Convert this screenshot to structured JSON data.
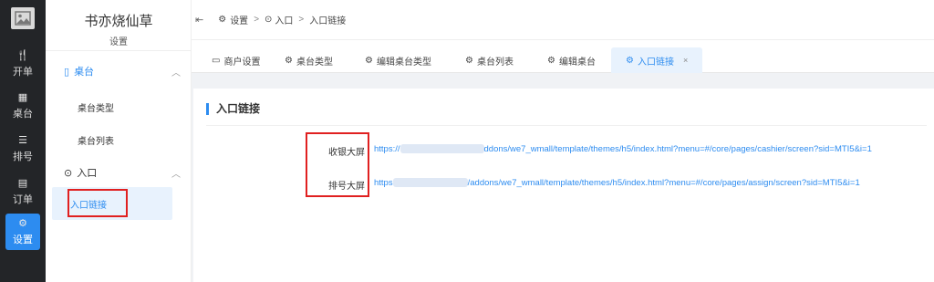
{
  "rail": {
    "items": [
      {
        "icon": "🍴",
        "label": "开单"
      },
      {
        "icon": "▦",
        "label": "桌台"
      },
      {
        "icon": "☰",
        "label": "排号"
      },
      {
        "icon": "▤",
        "label": "订单"
      },
      {
        "icon": "⚙",
        "label": "设置"
      }
    ]
  },
  "sidebar": {
    "brand": "书亦烧仙草",
    "subtitle": "设置",
    "groups": [
      {
        "label": "桌台",
        "icon": "▯",
        "items": [
          "桌台类型",
          "桌台列表"
        ]
      },
      {
        "label": "入口",
        "icon": "⊙",
        "items": [
          "入口链接"
        ]
      }
    ]
  },
  "breadcrumb": {
    "fold_icon": "⇤",
    "items": [
      "设置",
      "入口",
      "入口链接"
    ],
    "separator": ">"
  },
  "tabs": [
    {
      "label": "商户设置",
      "icon": "▭"
    },
    {
      "label": "桌台类型",
      "icon": "⚙"
    },
    {
      "label": "编辑桌台类型",
      "icon": "⚙"
    },
    {
      "label": "桌台列表",
      "icon": "⚙"
    },
    {
      "label": "编辑桌台",
      "icon": "⚙"
    },
    {
      "label": "入口链接",
      "icon": "⚙",
      "close": "×"
    }
  ],
  "content": {
    "title": "入口链接",
    "rows": [
      {
        "label": "收银大屏",
        "url_prefix": "https://",
        "url_suffix": "ddons/we7_wmall/template/themes/h5/index.html?menu=#/core/pages/cashier/screen?sid=MTI5&i=1"
      },
      {
        "label": "排号大屏",
        "url_prefix": "https",
        "url_suffix": "/addons/we7_wmall/template/themes/h5/index.html?menu=#/core/pages/assign/screen?sid=MTI5&i=1"
      }
    ]
  },
  "colors": {
    "accent": "#2d8cf0",
    "rail_bg": "#232528",
    "highlight_border": "#e02020"
  }
}
